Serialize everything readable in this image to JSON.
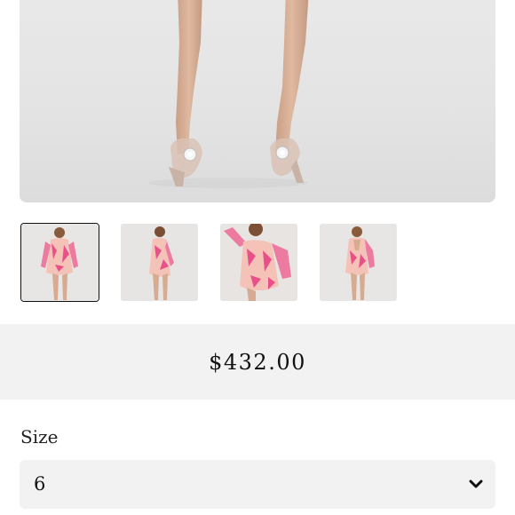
{
  "product": {
    "price": "$432.00"
  },
  "gallery": {
    "main_image": "model-legs-clear-heels",
    "thumbnails": [
      {
        "image": "dress-front-view",
        "selected": true
      },
      {
        "image": "dress-side-view",
        "selected": false
      },
      {
        "image": "dress-closeup-pose",
        "selected": false
      },
      {
        "image": "dress-back-view",
        "selected": false
      }
    ]
  },
  "size": {
    "label": "Size",
    "selected": "6",
    "icon": "chevron-down-icon"
  },
  "colors": {
    "band": "#f2f2f2",
    "text": "#111111",
    "dress_pink": "#e9508a",
    "dress_peach": "#f4c2b6"
  }
}
